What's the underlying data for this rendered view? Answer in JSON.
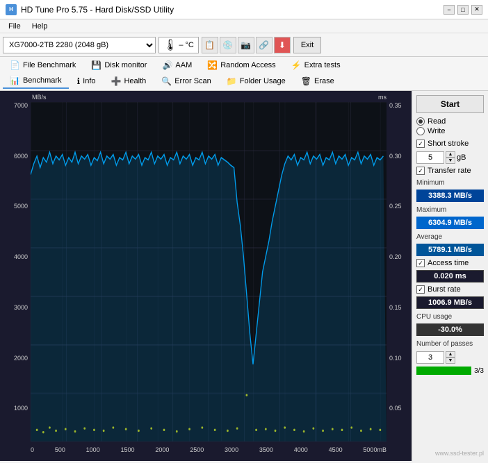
{
  "titlebar": {
    "title": "HD Tune Pro 5.75 - Hard Disk/SSD Utility",
    "min_label": "−",
    "max_label": "□",
    "close_label": "✕"
  },
  "menu": {
    "file_label": "File",
    "help_label": "Help"
  },
  "toolbar": {
    "drive_name": "XG7000-2TB 2280 (2048 gB)",
    "temp_label": "– °C",
    "exit_label": "Exit"
  },
  "tabs": {
    "row1": [
      {
        "icon": "📄",
        "label": "File Benchmark"
      },
      {
        "icon": "💾",
        "label": "Disk monitor"
      },
      {
        "icon": "🔊",
        "label": "AAM"
      },
      {
        "icon": "🔀",
        "label": "Random Access"
      },
      {
        "icon": "⚡",
        "label": "Extra tests"
      }
    ],
    "row2": [
      {
        "icon": "📊",
        "label": "Benchmark"
      },
      {
        "icon": "ℹ",
        "label": "Info"
      },
      {
        "icon": "➕",
        "label": "Health"
      },
      {
        "icon": "🔍",
        "label": "Error Scan"
      },
      {
        "icon": "📁",
        "label": "Folder Usage"
      },
      {
        "icon": "🗑",
        "label": "Erase"
      }
    ]
  },
  "chart": {
    "y_left_labels": [
      "7000",
      "6000",
      "5000",
      "4000",
      "3000",
      "2000",
      "1000",
      ""
    ],
    "y_right_labels": [
      "0.35",
      "0.30",
      "0.25",
      "0.20",
      "0.15",
      "0.10",
      "0.05",
      ""
    ],
    "x_labels": [
      "0",
      "500",
      "1000",
      "1500",
      "2000",
      "2500",
      "3000",
      "3500",
      "4000",
      "4500",
      "5000mB"
    ],
    "top_left_label": "MB/s",
    "top_right_label": "ms"
  },
  "right_panel": {
    "start_label": "Start",
    "read_label": "Read",
    "write_label": "Write",
    "short_stroke_label": "Short stroke",
    "short_stroke_value": "5",
    "short_stroke_unit": "gB",
    "transfer_rate_label": "Transfer rate",
    "minimum_label": "Minimum",
    "minimum_value": "3388.3 MB/s",
    "maximum_label": "Maximum",
    "maximum_value": "6304.9 MB/s",
    "average_label": "Average",
    "average_value": "5789.1 MB/s",
    "access_time_label": "Access time",
    "access_time_value": "0.020 ms",
    "burst_rate_label": "Burst rate",
    "burst_rate_value": "1006.9 MB/s",
    "cpu_usage_label": "CPU usage",
    "cpu_usage_value": "-30.0%",
    "passes_label": "Number of passes",
    "passes_value": "3",
    "passes_display": "3/3",
    "passes_percent": 100
  },
  "watermark": "www.ssd-tester.pl"
}
